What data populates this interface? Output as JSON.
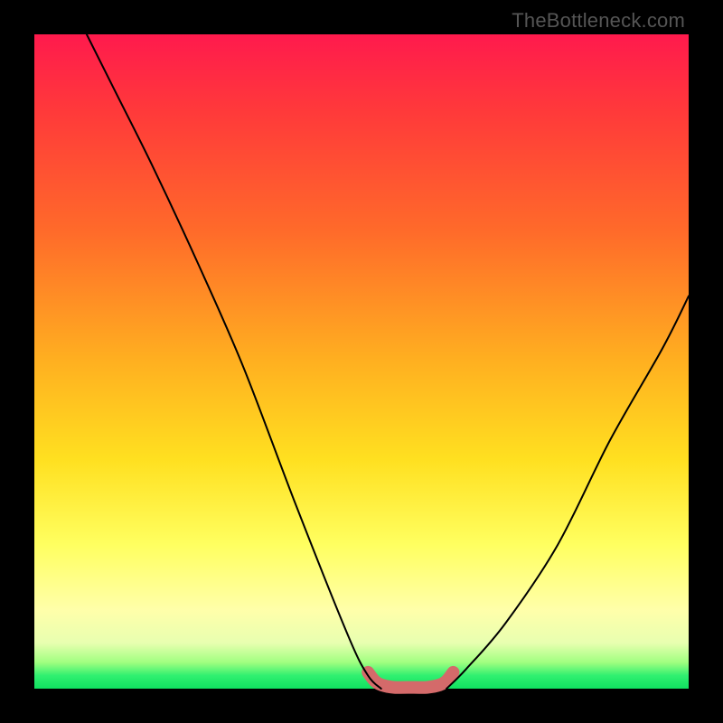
{
  "watermark": "TheBottleneck.com",
  "chart_data": {
    "type": "line",
    "title": "",
    "xlabel": "",
    "ylabel": "",
    "xlim": [
      0,
      100
    ],
    "ylim": [
      0,
      100
    ],
    "grid": false,
    "legend": false,
    "series": [
      {
        "name": "left-curve",
        "stroke": "#000000",
        "x": [
          8,
          12,
          18,
          25,
          32,
          40,
          48,
          51,
          53
        ],
        "y": [
          100,
          92,
          80,
          65,
          49,
          28,
          8,
          2,
          0
        ]
      },
      {
        "name": "right-curve",
        "stroke": "#000000",
        "x": [
          63,
          66,
          72,
          80,
          88,
          96,
          100
        ],
        "y": [
          0,
          3,
          10,
          22,
          38,
          52,
          60
        ]
      },
      {
        "name": "bottom-basin",
        "stroke": "#d46a6a",
        "x": [
          51,
          52,
          53,
          55,
          58,
          60,
          62,
          63,
          64
        ],
        "y": [
          2.5,
          1.2,
          0.6,
          0.2,
          0.2,
          0.2,
          0.6,
          1.2,
          2.5
        ]
      }
    ],
    "background_gradient": {
      "top": "#ff1a4d",
      "mid": "#ffe020",
      "bottom": "#10e060"
    }
  }
}
